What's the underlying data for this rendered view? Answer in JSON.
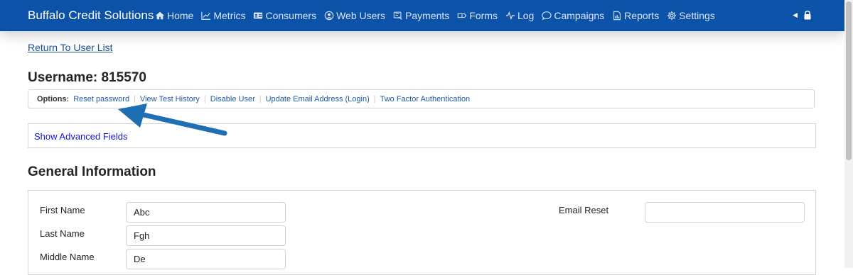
{
  "navbar": {
    "brand": "Buffalo Credit Solutions",
    "items": [
      {
        "label": "Home",
        "icon": "home-icon"
      },
      {
        "label": "Metrics",
        "icon": "chart-line-icon"
      },
      {
        "label": "Consumers",
        "icon": "id-card-icon"
      },
      {
        "label": "Web Users",
        "icon": "user-circle-icon"
      },
      {
        "label": "Payments",
        "icon": "payment-icon"
      },
      {
        "label": "Forms",
        "icon": "forms-icon"
      },
      {
        "label": "Log",
        "icon": "activity-icon"
      },
      {
        "label": "Campaigns",
        "icon": "chat-icon"
      },
      {
        "label": "Reports",
        "icon": "report-icon"
      },
      {
        "label": "Settings",
        "icon": "gear-icon"
      }
    ],
    "right_icons": [
      "caret-left-icon",
      "lock-icon"
    ]
  },
  "back_link": "Return To User List",
  "page_title": "Username: 815570",
  "options": {
    "label": "Options:",
    "links": [
      "Reset password",
      "View Test History",
      "Disable User",
      "Update Email Address (Login)",
      "Two Factor Authentication"
    ]
  },
  "advanced_fields_link": "Show Advanced Fields",
  "general_info": {
    "title": "General Information",
    "fields": [
      {
        "label": "First Name",
        "value": "Abc"
      },
      {
        "label": "Last Name",
        "value": "Fgh"
      },
      {
        "label": "Middle Name",
        "value": "De"
      }
    ],
    "email_reset": {
      "label": "Email Reset",
      "value": ""
    }
  },
  "colors": {
    "navbar": "#0b52a8",
    "annotation_arrow": "#1f6fb5",
    "link": "#1a5ba6"
  }
}
